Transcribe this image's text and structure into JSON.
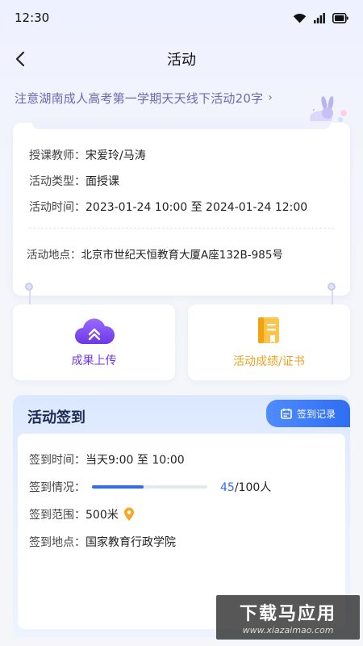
{
  "status": {
    "time": "12:30"
  },
  "nav": {
    "title": "活动"
  },
  "activity": {
    "title": "注意湖南成人高考第一学期天天线下活动20字",
    "chevron": "›"
  },
  "info": {
    "teacher_label": "授课教师：",
    "teacher_value": "宋爱玲/马涛",
    "type_label": "活动类型：",
    "type_value": "面授课",
    "time_label": "活动时间：",
    "time_value": "2023-01-24 10:00 至 2024-01-24 12:00",
    "location_label": "活动地点：",
    "location_value": "北京市世纪天恒教育大厦A座132B-985号"
  },
  "actions": {
    "upload_label": "成果上传",
    "upload_color": "#6c38e6",
    "cert_label": "活动成绩/证书",
    "cert_color": "#f0a020"
  },
  "signin": {
    "title": "活动签到",
    "record_label": "签到记录",
    "time_label": "签到时间：",
    "time_value": "当天9:00 至 10:00",
    "status_label": "签到情况：",
    "current": "45",
    "total_text": "/100人",
    "progress": 0.45,
    "range_label": "签到范围：",
    "range_value": "500米",
    "place_label": "签到地点：",
    "place_value": "国家教育行政学院"
  },
  "watermark": {
    "big": "下载马应用",
    "small": "www.xiazaimao.com"
  }
}
